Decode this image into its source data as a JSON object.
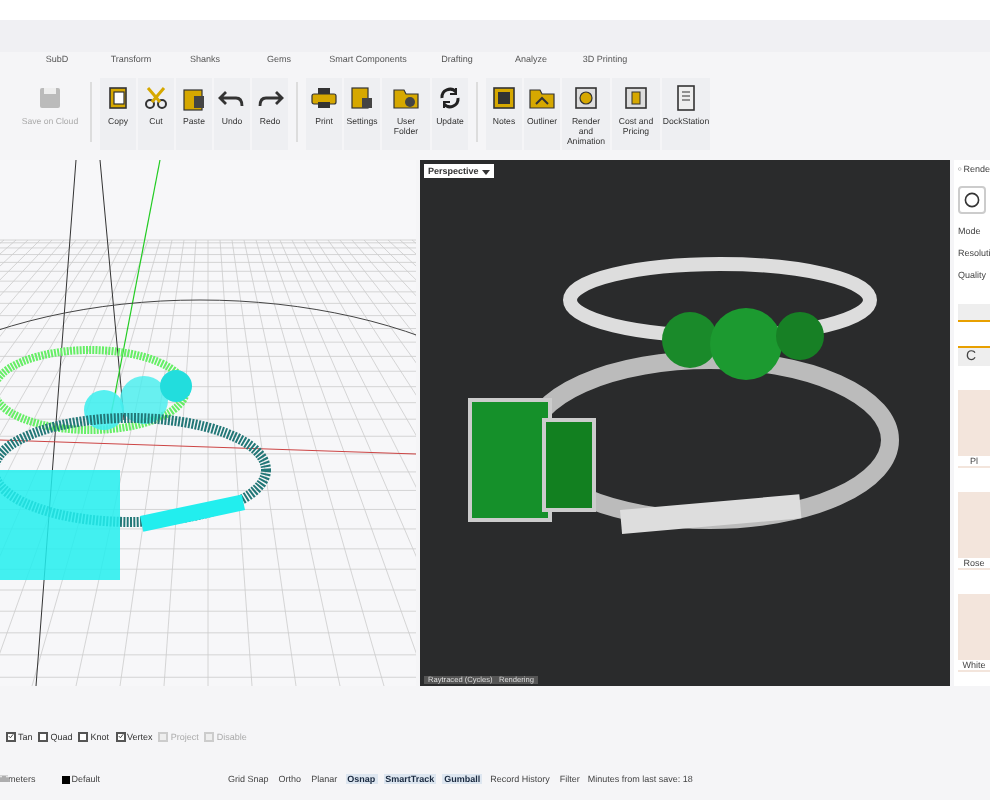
{
  "tabs": [
    {
      "label": "SubD",
      "selected": false
    },
    {
      "label": "Transform",
      "selected": false
    },
    {
      "label": "Shanks",
      "selected": false
    },
    {
      "label": "Gems",
      "selected": false
    },
    {
      "label": "Smart Components",
      "selected": false
    },
    {
      "label": "Drafting",
      "selected": false
    },
    {
      "label": "Analyze",
      "selected": false
    },
    {
      "label": "3D Printing",
      "selected": false
    }
  ],
  "toolbar": [
    {
      "label": "Save on Cloud",
      "disabled": true
    },
    {
      "label": "Copy",
      "disabled": false
    },
    {
      "label": "Cut",
      "disabled": false
    },
    {
      "label": "Paste",
      "disabled": false
    },
    {
      "label": "Undo",
      "disabled": false
    },
    {
      "label": "Redo",
      "disabled": false
    },
    {
      "label": "Print",
      "disabled": false
    },
    {
      "label": "Settings",
      "disabled": false
    },
    {
      "label": "User Folder",
      "disabled": false
    },
    {
      "label": "Update",
      "disabled": false
    },
    {
      "label": "Notes",
      "disabled": false
    },
    {
      "label": "Outliner",
      "disabled": false
    },
    {
      "label": "Render and Animation",
      "disabled": false
    },
    {
      "label": "Cost and Pricing",
      "disabled": false
    },
    {
      "label": "DockStation",
      "disabled": false
    }
  ],
  "render_viewport": {
    "title": "Perspective",
    "footer": "Raytraced (Cycles)   Rendering"
  },
  "render_panel": {
    "radio": {
      "label": "Rende",
      "selected": false
    },
    "fields": [
      "Mode",
      "Resoluti",
      "Quality"
    ],
    "tab": "C",
    "materials": [
      "Pl",
      "Rose",
      "White"
    ]
  },
  "options": [
    {
      "label": "Tan",
      "checked": true,
      "disabled": false
    },
    {
      "label": "Quad",
      "checked": false,
      "disabled": false
    },
    {
      "label": "Knot",
      "checked": false,
      "disabled": false
    },
    {
      "label": "Vertex",
      "checked": true,
      "disabled": false
    },
    {
      "label": "Project",
      "checked": false,
      "disabled": true
    },
    {
      "label": "Disable",
      "checked": false,
      "disabled": true
    }
  ],
  "status_bar": {
    "units": "illimeters",
    "layer": "Default",
    "toggles": [
      {
        "label": "Grid Snap",
        "on": false
      },
      {
        "label": "Ortho",
        "on": false
      },
      {
        "label": "Planar",
        "on": false
      },
      {
        "label": "Osnap",
        "on": true
      },
      {
        "label": "SmartTrack",
        "on": true
      },
      {
        "label": "Gumball",
        "on": true
      },
      {
        "label": "Record History",
        "on": false
      },
      {
        "label": "Filter",
        "on": false
      }
    ],
    "save_info": "Minutes from last save: 18"
  }
}
